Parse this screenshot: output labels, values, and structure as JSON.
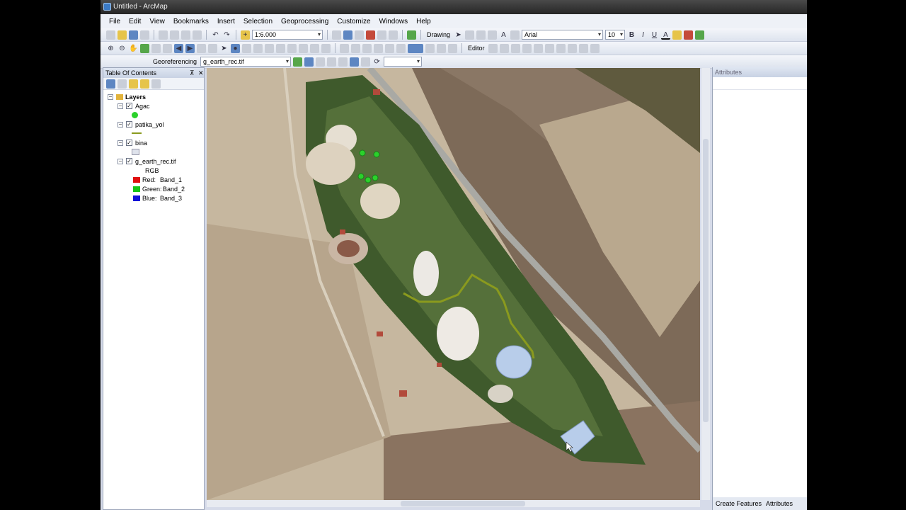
{
  "window": {
    "title": "Untitled - ArcMap"
  },
  "menu": [
    "File",
    "Edit",
    "View",
    "Bookmarks",
    "Insert",
    "Selection",
    "Geoprocessing",
    "Customize",
    "Windows",
    "Help"
  ],
  "toolbar": {
    "scale": "1:6.000",
    "drawing_label": "Drawing",
    "font_name": "Arial",
    "font_size": "10",
    "bold": "B",
    "italic": "I",
    "underline": "U",
    "font_color_glyph": "A",
    "editor_label": "Editor",
    "georeferencing_label": "Georeferencing",
    "georef_layer": "g_earth_rec.tif"
  },
  "toc": {
    "title": "Table Of Contents",
    "pin": "⊼",
    "close": "✕",
    "root": "Layers",
    "layers": [
      {
        "name": "Agac",
        "checked": true,
        "symbol_color": "#2bd12b"
      },
      {
        "name": "patika_yol",
        "checked": true,
        "symbol_color": "#8a9a1e"
      },
      {
        "name": "bina",
        "checked": true,
        "symbol_color": "#dfe3ec"
      },
      {
        "name": "g_earth_rec.tif",
        "checked": true
      }
    ],
    "raster_legend": {
      "title": "RGB",
      "bands": [
        {
          "label": "Red:",
          "band": "Band_1",
          "color": "#e01010"
        },
        {
          "label": "Green:",
          "band": "Band_2",
          "color": "#18c418"
        },
        {
          "label": "Blue:",
          "band": "Band_3",
          "color": "#1010d8"
        }
      ]
    }
  },
  "attributes_panel": {
    "title": "Attributes",
    "tabs": [
      "Create Features",
      "Attributes"
    ]
  }
}
